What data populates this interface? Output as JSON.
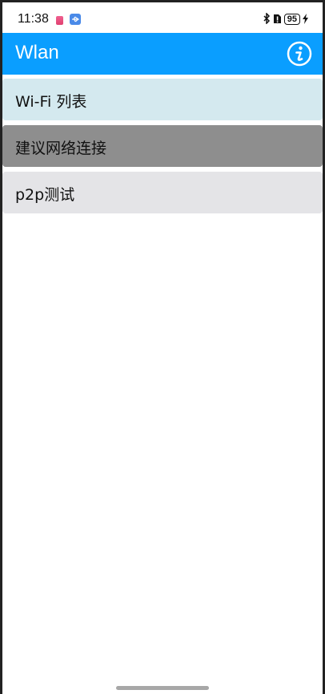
{
  "status_bar": {
    "time": "11:38",
    "battery_level": "95"
  },
  "app_bar": {
    "title": "Wlan",
    "info_icon": "info-icon"
  },
  "list": {
    "items": [
      {
        "label": "Wi-Fi 列表"
      },
      {
        "label": "建议网络连接"
      },
      {
        "label": "p2p测试"
      }
    ]
  },
  "colors": {
    "app_bar": "#0a9eff",
    "item_wifi_list": "#d4e9ef",
    "item_suggested_pressed": "#8e8e8e",
    "item_p2p": "#e4e4e7"
  }
}
